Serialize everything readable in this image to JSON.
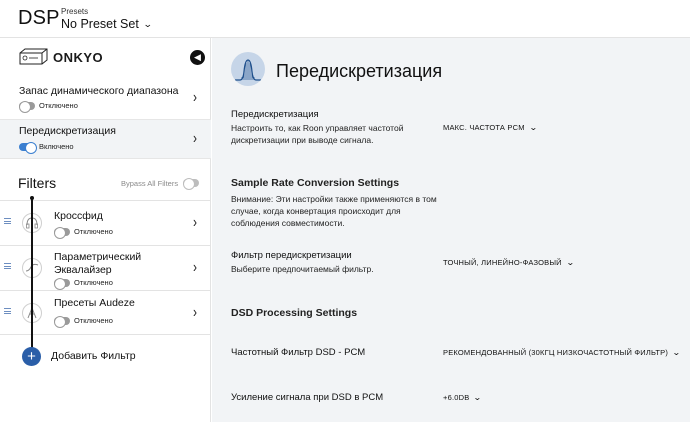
{
  "header": {
    "title": "DSP",
    "presets_label": "Presets",
    "preset_value": "No Preset Set"
  },
  "sidebar": {
    "device_name": "ONKYO",
    "items": [
      {
        "label": "Запас динамического диапазона",
        "status": "Отключено",
        "enabled": false
      },
      {
        "label": "Передискретизация",
        "status": "Включено",
        "enabled": true
      }
    ],
    "filters_title": "Filters",
    "bypass_label": "Bypass All Filters",
    "filters": [
      {
        "name": "Кроссфид",
        "status": "Отключено"
      },
      {
        "name_line1": "Параметрический",
        "name_line2": "Эквалайзер",
        "status": "Отключено"
      },
      {
        "name": "Пресеты Audeze",
        "status": "Отключено"
      }
    ],
    "add_filter_label": "Добавить Фильтр"
  },
  "main": {
    "title": "Передискретизация",
    "sample_rate": {
      "title": "Передискретизация",
      "desc": "Настроить то, как Roon управляет частотой дискретизации при выводе сигнала.",
      "value": "МАКС. ЧАСТОТА PCM"
    },
    "src_section": {
      "title": "Sample Rate Conversion Settings",
      "desc": "Внимание: Эти настройки также применяются в том случае, когда конвертация происходит для соблюдения совместимости."
    },
    "filter": {
      "title": "Фильтр передискретизации",
      "desc": "Выберите предпочитаемый фильтр.",
      "value": "ТОЧНЫЙ, ЛИНЕЙНО-ФАЗОВЫЙ"
    },
    "dsd_section": {
      "title": "DSD Processing Settings"
    },
    "dsd_filter": {
      "title": "Частотный Фильтр DSD - PCM",
      "value": "РЕКОМЕНДОВАННЫЙ (30КГЦ НИЗКОЧАСТОТНЫЙ ФИЛЬТР)"
    },
    "dsd_gain": {
      "title": "Усиление сигнала при DSD в PCM",
      "value": "+6.0DB"
    }
  },
  "colors": {
    "accent": "#3b7fd0",
    "add_button": "#2a5ea8",
    "main_bg": "#f2f4f6",
    "hero_icon_bg": "#c6d5e8"
  },
  "icons": {
    "device": "amplifier-icon",
    "collapse": "chevron-left-icon",
    "arrow": "chevron-right-icon",
    "dropdown": "chevron-down-icon",
    "add": "plus-icon",
    "hero": "waveform-icon"
  }
}
